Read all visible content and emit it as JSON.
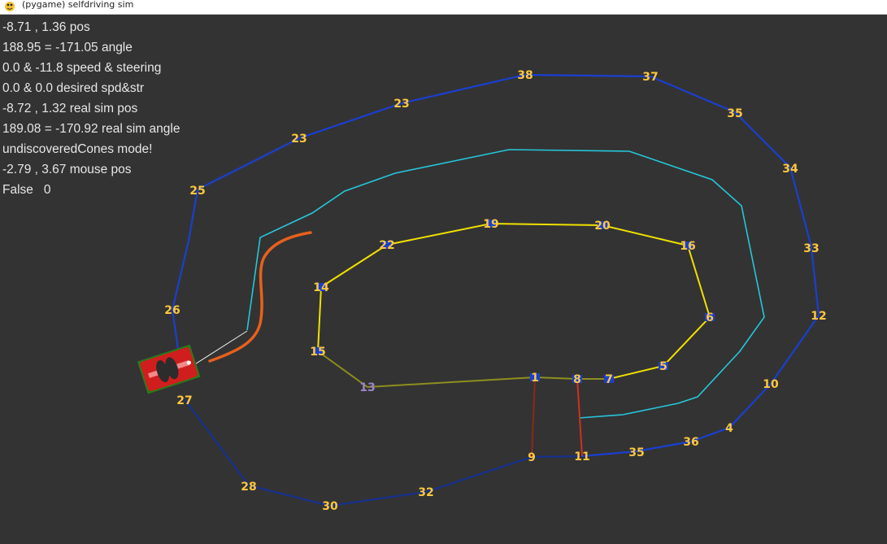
{
  "window": {
    "title": "(pygame) selfdriving sim",
    "icon": "pygame-snake-icon"
  },
  "hud": [
    {
      "name": "hud-pos",
      "text": "-8.71 , 1.36 pos"
    },
    {
      "name": "hud-angle",
      "text": "188.95 = -171.05 angle"
    },
    {
      "name": "hud-speed-steering",
      "text": "0.0 & -11.8 speed & steering"
    },
    {
      "name": "hud-desired",
      "text": "0.0 & 0.0 desired spd&str"
    },
    {
      "name": "hud-real-sim-pos",
      "text": "-8.72 , 1.32 real sim pos"
    },
    {
      "name": "hud-real-sim-angle",
      "text": "189.08 = -170.92 real sim angle"
    },
    {
      "name": "hud-mode",
      "text": "undiscoveredCones mode!"
    },
    {
      "name": "hud-mouse-pos",
      "text": "-2.79 , 3.67 mouse pos"
    },
    {
      "name": "hud-flag",
      "text": "False   0"
    }
  ],
  "colors": {
    "background": "#333333",
    "outer_boundary": "#1a3fd0",
    "outer_boundary_dark": "#17318f",
    "inner_boundary": "#f0e000",
    "inner_boundary_faded": "#8e8e20",
    "centerline": "#26c6da",
    "path_trail": "#e8601c",
    "finish_line": "#d03020",
    "finish_line_dark": "#8a2a1a",
    "cone_label": "#ffc83c",
    "car_body": "#d01e1e",
    "car_shadow": "#2a7a1a"
  },
  "outer_cones": [
    "25",
    "23",
    "23",
    "38",
    "37",
    "35",
    "34",
    "33",
    "12",
    "10",
    "4",
    "36",
    "35",
    "11",
    "9",
    "32",
    "30",
    "28",
    "27",
    "26"
  ],
  "inner_cones": [
    "22",
    "19",
    "20",
    "16",
    "6",
    "5",
    "7",
    "8",
    "1",
    "13",
    "15",
    "14"
  ],
  "cones_note_faded": [
    "13"
  ]
}
